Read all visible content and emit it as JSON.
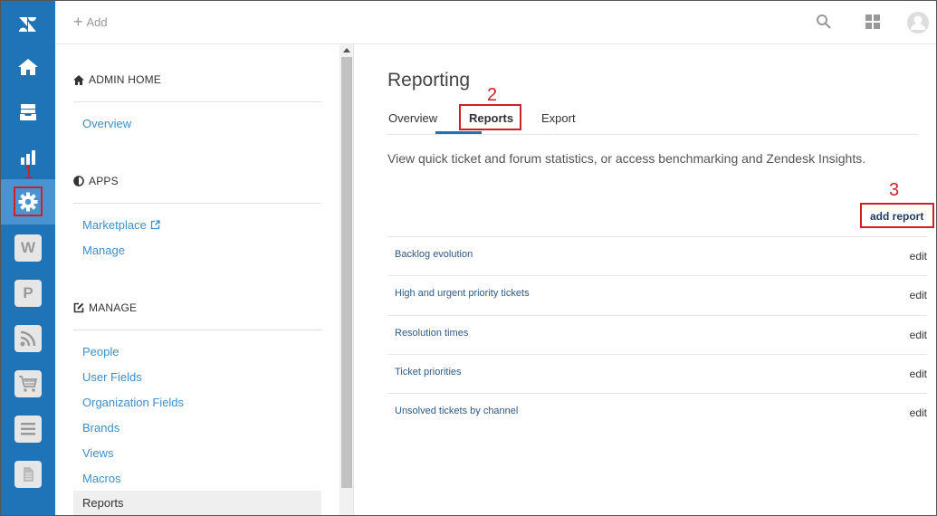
{
  "topbar": {
    "add_label": "Add"
  },
  "rail": {
    "icons": [
      "zendesk-logo-icon",
      "home-icon",
      "views-icon",
      "reporting-icon",
      "admin-gear-icon",
      "wordpress-app-icon",
      "p-app-icon",
      "rss-app-icon",
      "shopping-cart-app-icon",
      "list-app-icon",
      "document-app-icon"
    ],
    "w_app_letter": "W",
    "p_app_letter": "P"
  },
  "admin_nav": {
    "admin_home": {
      "heading": "ADMIN HOME",
      "items": [
        "Overview"
      ]
    },
    "apps": {
      "heading": "APPS",
      "items": [
        "Marketplace",
        "Manage"
      ]
    },
    "manage": {
      "heading": "MANAGE",
      "items": [
        "People",
        "User Fields",
        "Organization Fields",
        "Brands",
        "Views",
        "Macros",
        "Reports"
      ],
      "selected": "Reports"
    }
  },
  "main": {
    "title": "Reporting",
    "tabs": [
      "Overview",
      "Reports",
      "Export"
    ],
    "active_tab": "Reports",
    "description": "View quick ticket and forum statistics, or access benchmarking and Zendesk Insights.",
    "add_report_label": "add report",
    "reports": [
      {
        "name": "Backlog evolution",
        "action": "edit"
      },
      {
        "name": "High and urgent priority tickets",
        "action": "edit"
      },
      {
        "name": "Resolution times",
        "action": "edit"
      },
      {
        "name": "Ticket priorities",
        "action": "edit"
      },
      {
        "name": "Unsolved tickets by channel",
        "action": "edit"
      }
    ]
  },
  "annotations": [
    "1",
    "2",
    "3"
  ],
  "colors": {
    "rail": "#1f73b7",
    "rail_active": "#4a93d1",
    "link": "#3d8ecc",
    "annotation": "#d11f26"
  }
}
